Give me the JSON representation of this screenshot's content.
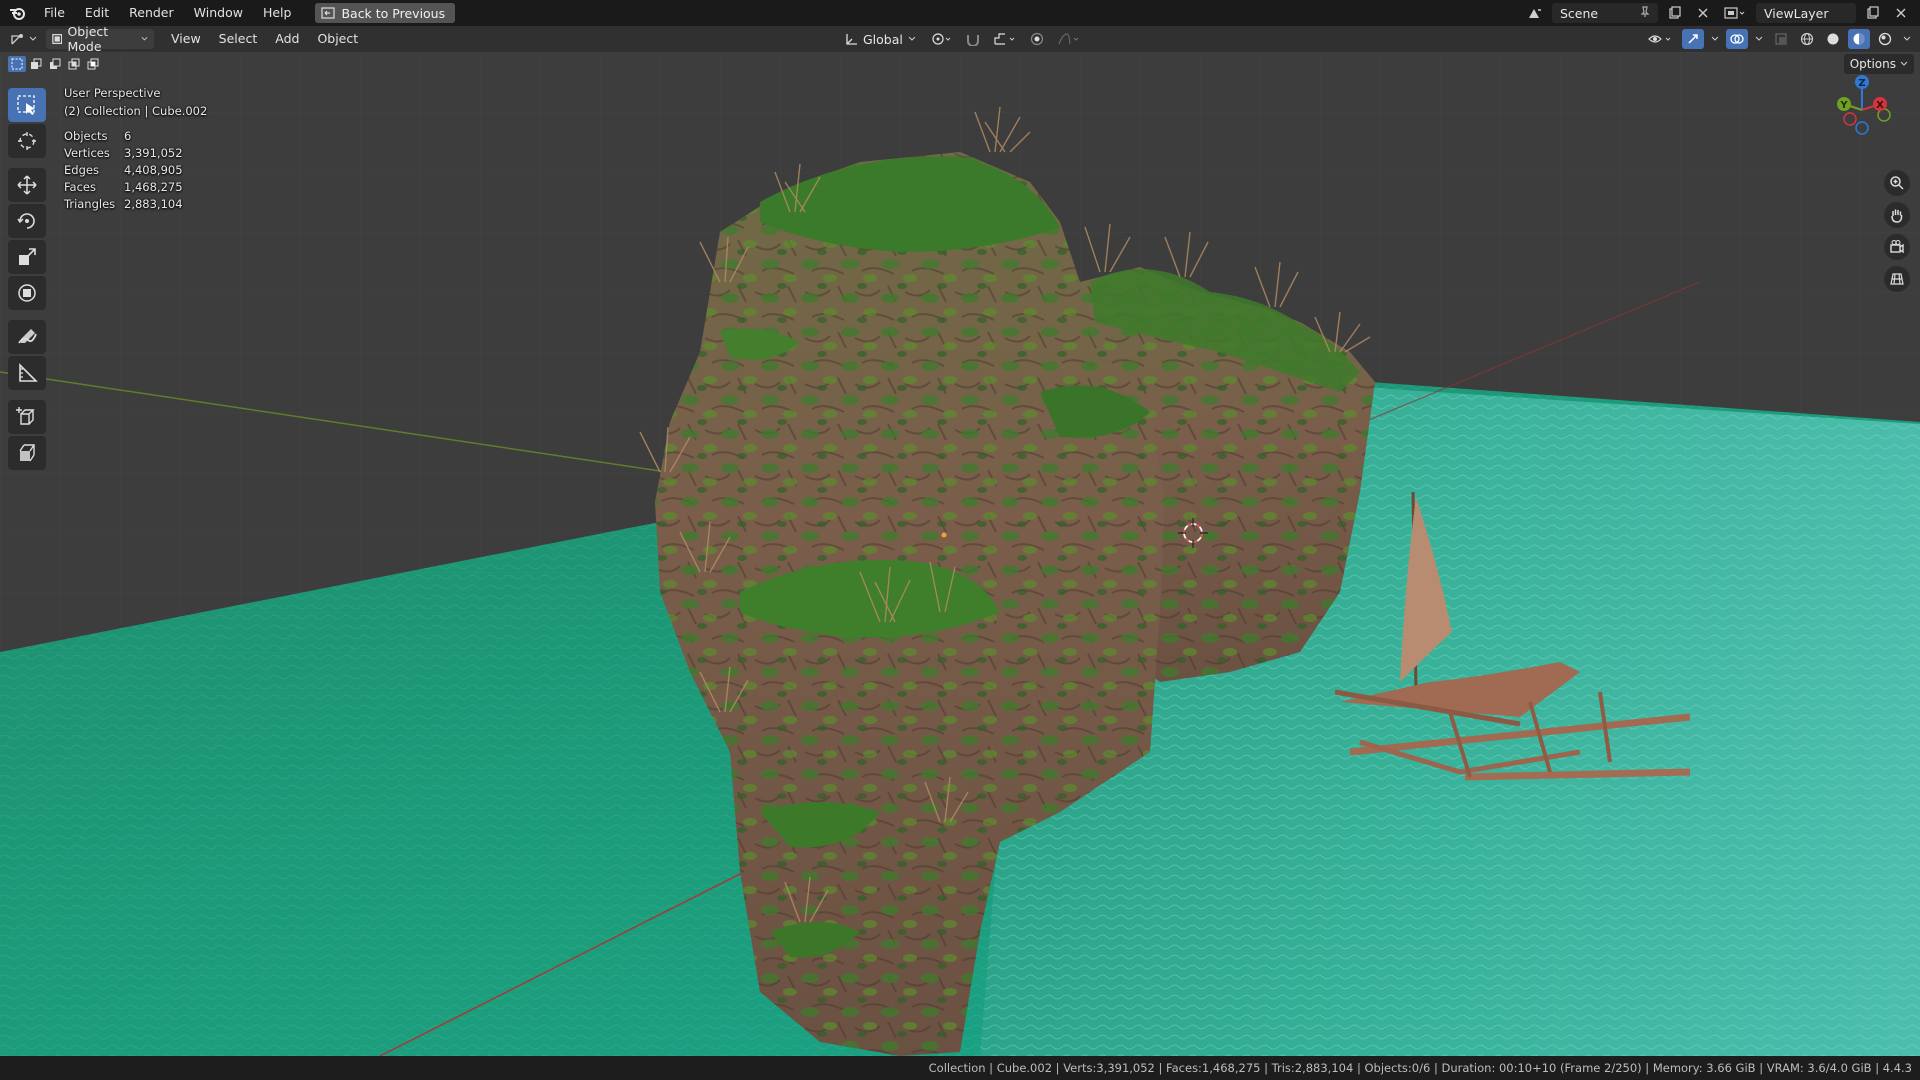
{
  "menu": {
    "items": [
      "File",
      "Edit",
      "Render",
      "Window",
      "Help"
    ],
    "back_button": "Back to Previous"
  },
  "topbar_right": {
    "scene": "Scene",
    "view_layer": "ViewLayer"
  },
  "viewport_header": {
    "mode": "Object Mode",
    "menus": [
      "View",
      "Select",
      "Add",
      "Object"
    ],
    "transform_orientation": "Global",
    "options": "Options"
  },
  "overlay": {
    "view_name": "User Perspective",
    "collection": "(2) Collection | Cube.002",
    "stats": [
      {
        "label": "Objects",
        "value": "6"
      },
      {
        "label": "Vertices",
        "value": "3,391,052"
      },
      {
        "label": "Edges",
        "value": "4,408,905"
      },
      {
        "label": "Faces",
        "value": "1,468,275"
      },
      {
        "label": "Triangles",
        "value": "2,883,104"
      }
    ]
  },
  "gizmo": {
    "x": "X",
    "y": "Y",
    "z": "Z"
  },
  "statusbar": {
    "text": "Collection | Cube.002 | Verts:3,391,052 | Faces:1,468,275 | Tris:2,883,104 | Objects:0/6 | Duration: 00:10+10 (Frame 2/250) | Memory: 3.66 GiB | VRAM: 3.6/4.0 GiB | 4.4.3"
  },
  "colors": {
    "accent": "#4772b3",
    "water": "#1f9a78",
    "rock": "#7a5c49",
    "moss": "#3f7a2c"
  }
}
